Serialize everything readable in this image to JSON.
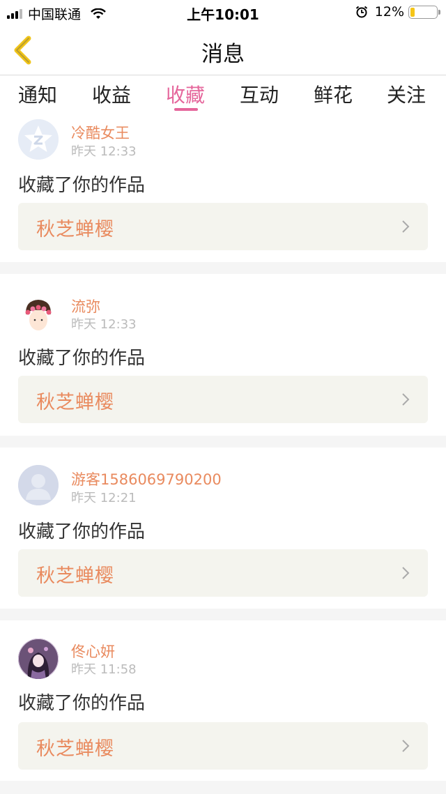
{
  "status_bar": {
    "carrier": "中国联通",
    "time": "上午10:01",
    "battery": "12%"
  },
  "nav": {
    "title": "消息",
    "back_icon": "chevron-left-icon"
  },
  "tabs": [
    {
      "label": "通知"
    },
    {
      "label": "收益"
    },
    {
      "label": "收藏",
      "active": true
    },
    {
      "label": "互动"
    },
    {
      "label": "鲜花"
    },
    {
      "label": "关注"
    }
  ],
  "messages": [
    {
      "username": "冷酷女王",
      "time": "昨天 12:33",
      "action": "收藏了你的作品",
      "work_title": "秋芝蝉樱"
    },
    {
      "username": "流弥",
      "time": "昨天 12:33",
      "action": "收藏了你的作品",
      "work_title": "秋芝蝉樱"
    },
    {
      "username": "游客1586069790200",
      "time": "昨天 12:21",
      "action": "收藏了你的作品",
      "work_title": "秋芝蝉樱"
    },
    {
      "username": "佟心妍",
      "time": "昨天 11:58",
      "action": "收藏了你的作品",
      "work_title": "秋芝蝉樱"
    }
  ],
  "colors": {
    "accent": "#e5659b",
    "username": "#e98a5e",
    "back_icon": "#f0c419"
  }
}
